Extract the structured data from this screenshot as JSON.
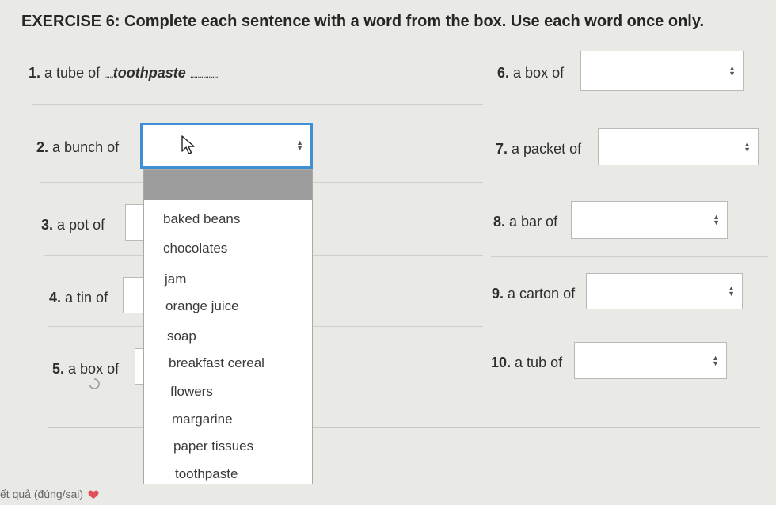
{
  "title": "EXERCISE 6: Complete each sentence with a word from the box. Use each word once only.",
  "items": [
    {
      "num": "1.",
      "text": "a tube of",
      "prefix_dots": ".....",
      "answer": "toothpaste",
      "suffix_dots": "...............",
      "type": "answered"
    },
    {
      "num": "2.",
      "text": "a bunch of",
      "type": "select",
      "state": "open",
      "value": ""
    },
    {
      "num": "3.",
      "text": "a pot of",
      "type": "select",
      "value": ""
    },
    {
      "num": "4.",
      "text": "a tin of",
      "type": "select",
      "value": ""
    },
    {
      "num": "5.",
      "text": "a box of",
      "type": "select",
      "value": ""
    },
    {
      "num": "6.",
      "text": "a box of",
      "type": "select",
      "value": ""
    },
    {
      "num": "7.",
      "text": "a packet of",
      "type": "select",
      "value": ""
    },
    {
      "num": "8.",
      "text": "a bar of",
      "type": "select",
      "value": ""
    },
    {
      "num": "9.",
      "text": "a carton of",
      "type": "select",
      "value": ""
    },
    {
      "num": "10.",
      "text": "a tub of",
      "type": "select",
      "value": ""
    }
  ],
  "dropdown": {
    "options": [
      "baked beans",
      "chocolates",
      "jam",
      "orange juice",
      "soap",
      "breakfast cereal",
      "flowers",
      "margarine",
      "paper tissues",
      "toothpaste"
    ]
  },
  "footer": {
    "text": "ết quả (đúng/sai)",
    "icon": "heart-icon"
  },
  "colors": {
    "focus": "#3f8fd6",
    "dropdown_header": "#9d9d9d",
    "heart": "#e0505a"
  }
}
